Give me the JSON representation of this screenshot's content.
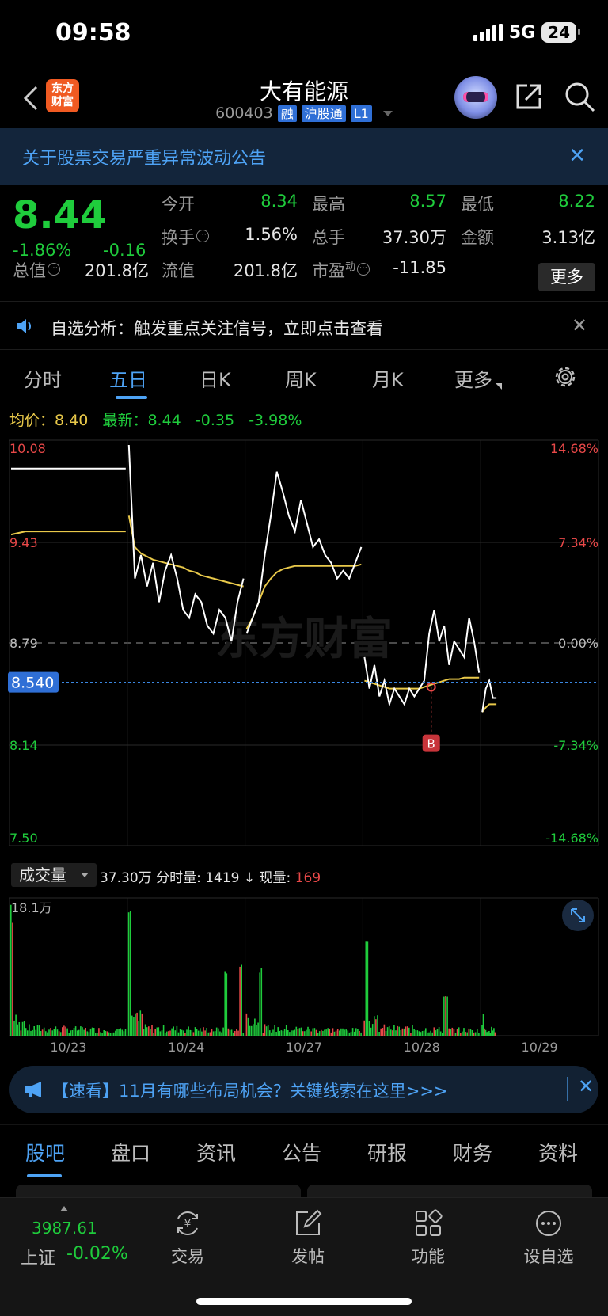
{
  "status": {
    "time": "09:58",
    "network": "5G",
    "battery": "24"
  },
  "header": {
    "logo_line1": "东方",
    "logo_line2": "财富",
    "title": "大有能源",
    "code": "600403",
    "tags": [
      "融",
      "沪股通",
      "L1"
    ]
  },
  "notice": {
    "text": "关于股票交易严重异常波动公告"
  },
  "quote": {
    "price": "8.44",
    "change_pct": "-1.86%",
    "change_abs": "-0.16",
    "open_label": "今开",
    "open": "8.34",
    "high_label": "最高",
    "high": "8.57",
    "low_label": "最低",
    "low": "8.22",
    "turnover_label": "换手",
    "turnover": "1.56%",
    "volume_label": "总手",
    "volume": "37.30万",
    "amount_label": "金额",
    "amount": "3.13亿",
    "mktcap_label": "总值",
    "mktcap": "201.8亿",
    "float_label": "流值",
    "float": "201.8亿",
    "pe_label": "市盈",
    "pe_sup": "动",
    "pe": "-11.85",
    "more": "更多"
  },
  "alert": {
    "text": "自选分析：触发重点关注信号，立即点击查看"
  },
  "chart_tabs": [
    "分时",
    "五日",
    "日K",
    "周K",
    "月K",
    "更多"
  ],
  "legend": {
    "avg_label": "均价：",
    "avg": "8.40",
    "last_label": "最新：",
    "last": "8.44",
    "chg": "-0.35",
    "pct": "-3.98%"
  },
  "chart_data": {
    "type": "line",
    "title": "",
    "y_axis_left": [
      "10.08",
      "9.43",
      "8.79",
      "8.14",
      "7.50"
    ],
    "y_axis_right": [
      "14.68%",
      "7.34%",
      "0.00%",
      "-7.34%",
      "-14.68%"
    ],
    "ylim": [
      7.5,
      10.08
    ],
    "reference_price": 8.79,
    "crosshair_price": "8.540",
    "x_labels": [
      "10/23",
      "10/24",
      "10/27",
      "10/28",
      "10/29"
    ],
    "marker_label": "B",
    "marker_day": 3,
    "marker_price": 8.51,
    "watermark": "东方财富",
    "series": [
      {
        "day": 0,
        "price": [
          9.9,
          9.9,
          9.9,
          9.9,
          9.9,
          9.9,
          9.9,
          9.9,
          9.9
        ],
        "avg": [
          9.48,
          9.5,
          9.5,
          9.5,
          9.5,
          9.5,
          9.5,
          9.5,
          9.5
        ]
      },
      {
        "day": 1,
        "price": [
          10.05,
          9.2,
          9.35,
          9.15,
          9.3,
          9.05,
          9.25,
          9.35,
          9.2,
          9.0,
          8.95,
          9.1,
          9.05,
          8.9,
          8.85,
          9.0,
          8.95,
          8.8,
          9.05,
          9.2
        ],
        "avg": [
          9.6,
          9.4,
          9.36,
          9.34,
          9.32,
          9.31,
          9.3,
          9.29,
          9.28,
          9.27,
          9.25,
          9.24,
          9.22,
          9.21,
          9.2,
          9.19,
          9.18,
          9.17,
          9.16,
          9.15
        ]
      },
      {
        "day": 2,
        "price": [
          8.85,
          8.95,
          9.05,
          9.35,
          9.6,
          9.88,
          9.75,
          9.6,
          9.5,
          9.7,
          9.55,
          9.4,
          9.45,
          9.35,
          9.3,
          9.2,
          9.25,
          9.2,
          9.3,
          9.4
        ],
        "avg": [
          8.88,
          8.95,
          9.05,
          9.15,
          9.2,
          9.24,
          9.26,
          9.27,
          9.28,
          9.28,
          9.28,
          9.28,
          9.28,
          9.28,
          9.28,
          9.28,
          9.28,
          9.28,
          9.28,
          9.29
        ]
      },
      {
        "day": 3,
        "price": [
          8.7,
          8.5,
          8.65,
          8.45,
          8.55,
          8.4,
          8.5,
          8.45,
          8.4,
          8.5,
          8.45,
          8.5,
          8.55,
          8.85,
          9.0,
          8.8,
          8.9,
          8.65,
          8.8,
          8.75,
          8.7,
          8.95,
          8.8,
          8.6
        ],
        "avg": [
          8.55,
          8.54,
          8.53,
          8.52,
          8.51,
          8.5,
          8.5,
          8.5,
          8.5,
          8.5,
          8.5,
          8.5,
          8.51,
          8.52,
          8.53,
          8.54,
          8.55,
          8.56,
          8.56,
          8.56,
          8.57,
          8.57,
          8.57,
          8.57
        ]
      },
      {
        "day": 4,
        "price": [
          8.35,
          8.5,
          8.55,
          8.44,
          8.44
        ],
        "avg": [
          8.35,
          8.38,
          8.4,
          8.4,
          8.4
        ]
      }
    ],
    "volume": {
      "max_label": "18.1万",
      "peaks": [
        [
          0,
          0,
          0.95
        ],
        [
          1,
          0,
          1.0
        ],
        [
          1,
          0.84,
          0.52
        ],
        [
          1,
          0.96,
          0.58
        ],
        [
          2,
          0.12,
          0.5
        ],
        [
          3,
          0.02,
          0.8
        ],
        [
          3,
          0.7,
          0.3
        ],
        [
          4,
          0.1,
          0.25
        ]
      ]
    }
  },
  "volume_panel": {
    "selector": "成交量",
    "total": "37.30万",
    "minute_label": "分时量:",
    "minute": "1419",
    "arrow": "↓",
    "current_label": "现量:",
    "current": "169"
  },
  "banner": {
    "text": "【速看】11月有哪些布局机会？关键线索在这里>>>"
  },
  "sub_tabs": [
    "股吧",
    "盘口",
    "资讯",
    "公告",
    "研报",
    "财务",
    "资料"
  ],
  "bottom": {
    "index_value": "3987.61",
    "index_name": "上证",
    "index_change": "-0.02%",
    "nav": [
      "交易",
      "发帖",
      "功能",
      "设自选"
    ]
  },
  "colors": {
    "up": "#e84848",
    "down": "#1fcc3c",
    "avg_line": "#e9c94a",
    "accent": "#4ea3f5"
  }
}
